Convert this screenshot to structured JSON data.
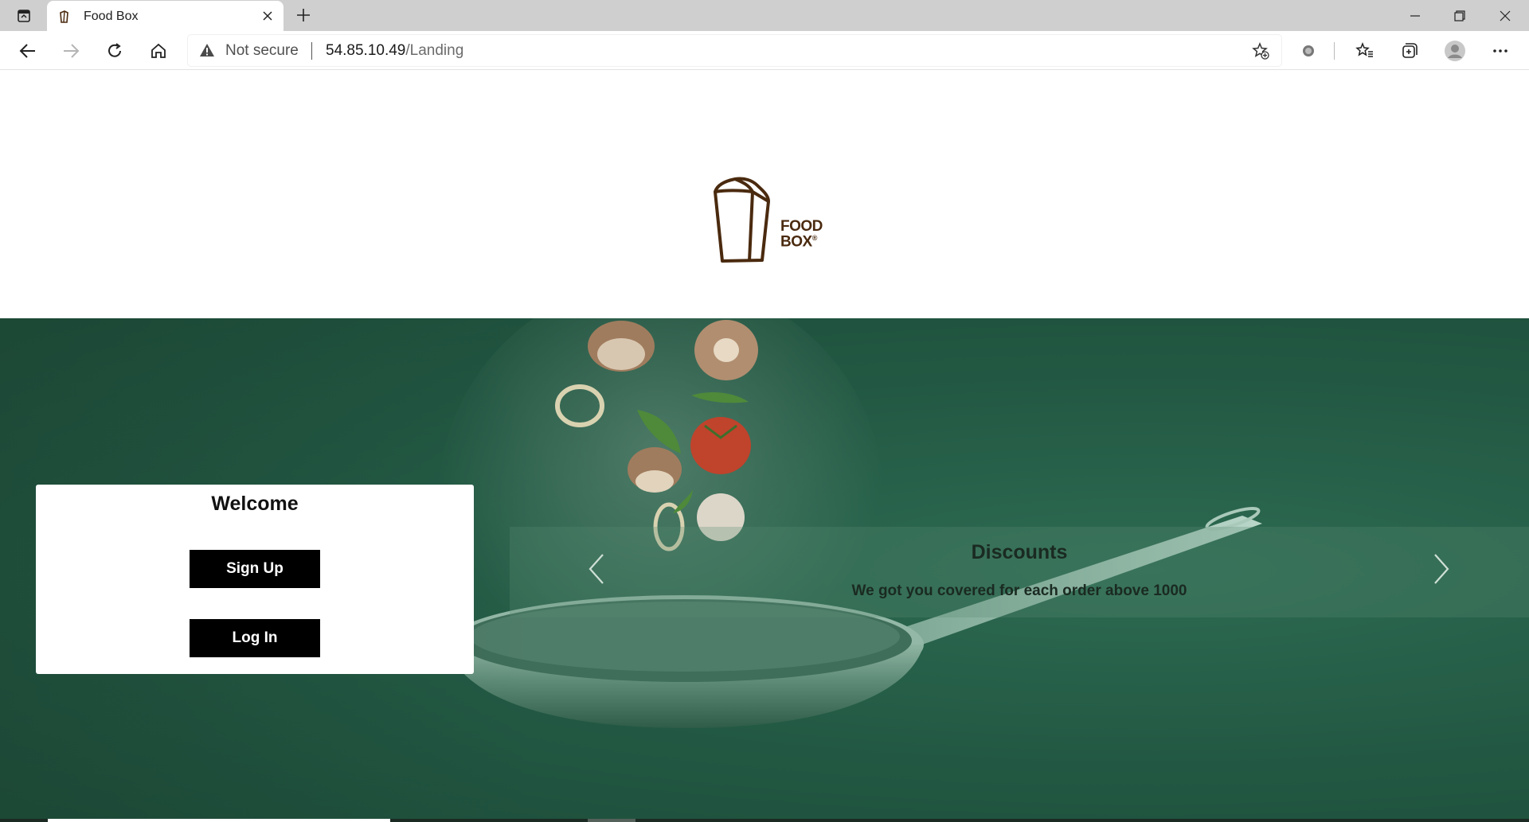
{
  "browser": {
    "tab_title": "Food Box",
    "address": {
      "security_label": "Not secure",
      "host": "54.85.10.49",
      "path": "/Landing"
    }
  },
  "page": {
    "logo": {
      "line1": "FOOD",
      "line2": "BOX",
      "reg": "®",
      "brand_color": "#4a2a0f"
    },
    "welcome": {
      "title": "Welcome",
      "signup_label": "Sign Up",
      "login_label": "Log In"
    },
    "carousel": {
      "caption_title": "Discounts",
      "caption_text": "We got you covered for each order above 1000",
      "prev_icon": "chevron-left-icon",
      "next_icon": "chevron-right-icon",
      "active_slide": 1,
      "slide_count": 3
    },
    "colors": {
      "hero_green": "#225843",
      "button_black": "#000000"
    }
  }
}
